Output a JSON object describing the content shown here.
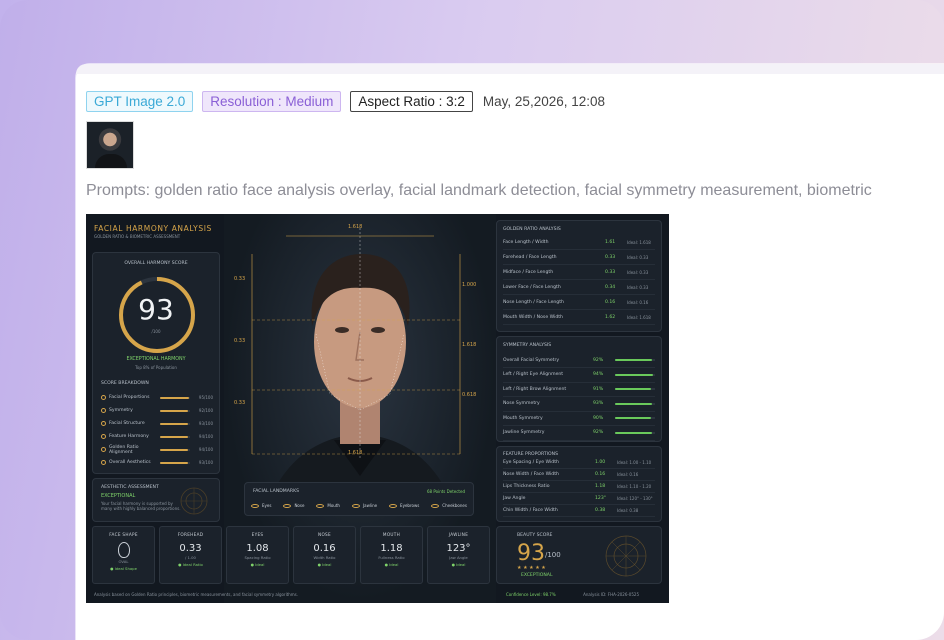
{
  "meta": {
    "model_tag": "GPT Image 2.0",
    "resolution_tag": "Resolution : Medium",
    "aspect_tag": "Aspect Ratio : 3:2",
    "datetime": "May, 25,2026, 12:08"
  },
  "prompt": "Prompts: golden ratio face analysis overlay, facial landmark detection, facial symmetry measurement, biometric",
  "image": {
    "title": "FACIAL HARMONY ANALYSIS",
    "subtitle": "GOLDEN RATIO & BIOMETRIC ASSESSMENT",
    "overall": {
      "label": "OVERALL HARMONY SCORE",
      "score": "93",
      "max": "/100",
      "grade": "EXCEPTIONAL HARMONY",
      "note": "Top 8% of Population"
    },
    "breakdown_label": "SCORE BREAKDOWN",
    "breakdown": [
      {
        "name": "Facial Proportions",
        "value": "95/100",
        "pct": 0.95
      },
      {
        "name": "Symmetry",
        "value": "92/100",
        "pct": 0.92
      },
      {
        "name": "Facial Structure",
        "value": "93/100",
        "pct": 0.93
      },
      {
        "name": "Feature Harmony",
        "value": "94/100",
        "pct": 0.94
      },
      {
        "name": "Golden Ratio Alignment",
        "value": "94/100",
        "pct": 0.94
      },
      {
        "name": "Overall Aesthetics",
        "value": "93/100",
        "pct": 0.93
      }
    ],
    "aesthetic": {
      "label": "AESTHETIC ASSESSMENT",
      "grade": "EXCEPTIONAL",
      "note": "Your facial harmony is supported by many with highly balanced proportions."
    },
    "face_marks": {
      "top": "1.618",
      "left_top": "0.33",
      "left_mid": "0.33",
      "left_bot": "0.33",
      "right_top": "1.000",
      "right_mid": "1.618",
      "right_bot": "0.618",
      "bottom": "1.618"
    },
    "landmarks": {
      "label": "FACIAL LANDMARKS",
      "status": "68 Points Detected",
      "items": [
        "Eyes",
        "Nose",
        "Mouth",
        "Jawline",
        "Eyebrows",
        "Cheekbones"
      ]
    },
    "golden": {
      "label": "GOLDEN RATIO ANALYSIS",
      "rows": [
        {
          "name": "Face Length / Width",
          "value": "1.61",
          "ideal": "Ideal: 1.618"
        },
        {
          "name": "Forehead / Face Length",
          "value": "0.33",
          "ideal": "Ideal: 0.33"
        },
        {
          "name": "Midface / Face Length",
          "value": "0.33",
          "ideal": "Ideal: 0.33"
        },
        {
          "name": "Lower Face / Face Length",
          "value": "0.34",
          "ideal": "Ideal: 0.33"
        },
        {
          "name": "Nose Length / Face Length",
          "value": "0.16",
          "ideal": "Ideal: 0.16"
        },
        {
          "name": "Mouth Width / Nose Width",
          "value": "1.62",
          "ideal": "Ideal: 1.618"
        }
      ]
    },
    "symmetry": {
      "label": "SYMMETRY ANALYSIS",
      "rows": [
        {
          "name": "Overall Facial Symmetry",
          "value": "92%",
          "pct": 0.92
        },
        {
          "name": "Left / Right Eye Alignment",
          "value": "94%",
          "pct": 0.94
        },
        {
          "name": "Left / Right Brow Alignment",
          "value": "91%",
          "pct": 0.91
        },
        {
          "name": "Nose Symmetry",
          "value": "93%",
          "pct": 0.93
        },
        {
          "name": "Mouth Symmetry",
          "value": "90%",
          "pct": 0.9
        },
        {
          "name": "Jawline Symmetry",
          "value": "92%",
          "pct": 0.92
        }
      ]
    },
    "features": {
      "label": "FEATURE PROPORTIONS",
      "rows": [
        {
          "name": "Eye Spacing / Eye Width",
          "value": "1.00",
          "ideal": "Ideal: 1.00 - 1.10"
        },
        {
          "name": "Nose Width / Face Width",
          "value": "0.16",
          "ideal": "Ideal: 0.16"
        },
        {
          "name": "Lips Thickness Ratio",
          "value": "1.18",
          "ideal": "Ideal: 1.10 - 1.20"
        },
        {
          "name": "Jaw Angle",
          "value": "123°",
          "ideal": "Ideal: 120° - 130°"
        },
        {
          "name": "Chin Width / Face Width",
          "value": "0.38",
          "ideal": "Ideal: 0.38"
        }
      ]
    },
    "cards": [
      {
        "title": "FACE SHAPE",
        "big": "",
        "sub": "OVAL",
        "ok": "Ideal Shape"
      },
      {
        "title": "FOREHEAD",
        "big": "0.33",
        "sub": "/ 1.00",
        "sub2": "Ideal Ratio",
        "ok": "Ideal Ratio"
      },
      {
        "title": "EYES",
        "big": "1.08",
        "sub": "Spacing Ratio",
        "ok": "Ideal"
      },
      {
        "title": "NOSE",
        "big": "0.16",
        "sub": "Width Ratio",
        "ok": "Ideal"
      },
      {
        "title": "MOUTH",
        "big": "1.18",
        "sub": "Fullness Ratio",
        "ok": "Ideal"
      },
      {
        "title": "JAWLINE",
        "big": "123°",
        "sub": "Jaw Angle",
        "ok": "Ideal"
      }
    ],
    "beauty": {
      "label": "BEAUTY SCORE",
      "score": "93",
      "max": "/100",
      "stars": "★ ★ ★ ★ ★",
      "grade": "EXCEPTIONAL"
    },
    "footer_left": "Analysis based on Golden Ratio principles, biometric measurements, and facial symmetry algorithms.",
    "footer_mid": "Confidence Level: 98.7%",
    "footer_right": "Analysis ID: FHA-2026-0525"
  },
  "colors": {
    "accent_gold": "#d6a54a",
    "accent_green": "#6ac95b"
  }
}
